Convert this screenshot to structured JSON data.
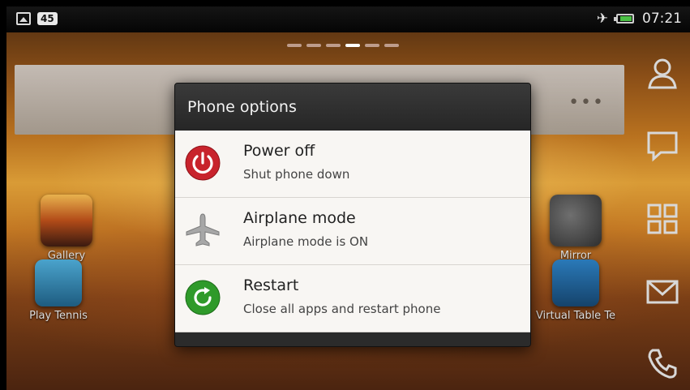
{
  "statusbar": {
    "notification_count": "45",
    "time": "07:21",
    "icons": [
      "gallery-icon",
      "airplane-icon",
      "battery-icon"
    ]
  },
  "home": {
    "page_indicator": {
      "count": 6,
      "active": 3
    },
    "apps": [
      {
        "label": "Gallery",
        "icon": "gallery-app-icon"
      },
      {
        "label": "Play Tennis",
        "icon": "tennis-app-icon"
      },
      {
        "label": "Mirror",
        "icon": "mirror-app-icon"
      },
      {
        "label": "Virtual Table Te",
        "icon": "table-tennis-app-icon"
      }
    ],
    "dock": [
      "people-icon",
      "messages-icon",
      "apps-grid-icon",
      "mail-icon",
      "phone-icon"
    ]
  },
  "dialog": {
    "title": "Phone options",
    "options": [
      {
        "title": "Power off",
        "subtitle": "Shut phone down",
        "icon": "power-icon",
        "color": "#c8232c"
      },
      {
        "title": "Airplane mode",
        "subtitle": "Airplane mode is ON",
        "icon": "airplane-icon",
        "color": "#9a9a9a"
      },
      {
        "title": "Restart",
        "subtitle": "Close all apps and restart phone",
        "icon": "restart-icon",
        "color": "#2f9a2a"
      }
    ]
  }
}
